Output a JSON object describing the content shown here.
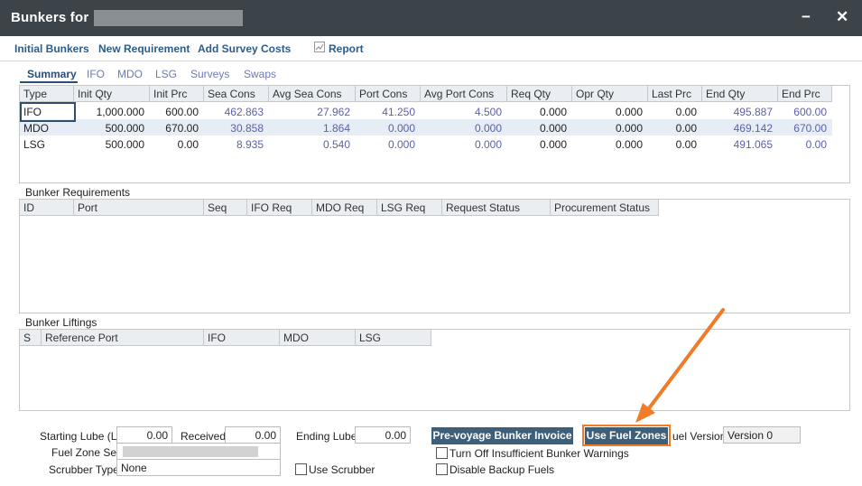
{
  "window": {
    "title": "Bunkers for",
    "minimize_glyph": "−",
    "close_glyph": "✕"
  },
  "toolbar": {
    "initial_bunkers": "Initial Bunkers",
    "new_requirement": "New Requirement",
    "add_survey_costs": "Add Survey Costs",
    "report": "Report",
    "report_icon": "chart-icon"
  },
  "tabs": [
    "Summary",
    "IFO",
    "MDO",
    "LSG",
    "Surveys",
    "Swaps"
  ],
  "summary": {
    "columns": [
      "Type",
      "Init Qty",
      "Init Prc",
      "Sea Cons",
      "Avg Sea Cons",
      "Port Cons",
      "Avg Port Cons",
      "Req Qty",
      "Opr Qty",
      "Last Prc",
      "End Qty",
      "End Prc"
    ],
    "rows": [
      [
        "IFO",
        "1,000.000",
        "600.00",
        "462.863",
        "27.962",
        "41.250",
        "4.500",
        "0.000",
        "0.000",
        "0.00",
        "495.887",
        "600.00"
      ],
      [
        "MDO",
        "500.000",
        "670.00",
        "30.858",
        "1.864",
        "0.000",
        "0.000",
        "0.000",
        "0.000",
        "0.00",
        "469.142",
        "670.00"
      ],
      [
        "LSG",
        "500.000",
        "0.00",
        "8.935",
        "0.540",
        "0.000",
        "0.000",
        "0.000",
        "0.000",
        "0.00",
        "491.065",
        "0.00"
      ]
    ]
  },
  "requirements": {
    "title": "Bunker Requirements",
    "columns": [
      "ID",
      "Port",
      "Seq",
      "IFO Req",
      "MDO Req",
      "LSG Req",
      "Request Status",
      "Procurement Status"
    ]
  },
  "liftings": {
    "title": "Bunker Liftings",
    "columns": [
      "S",
      "Reference Port",
      "IFO",
      "MDO",
      "LSG"
    ]
  },
  "footer": {
    "starting_lube_label": "Starting Lube (L)",
    "starting_lube_value": "0.00",
    "received_label": "Received",
    "received_value": "0.00",
    "ending_lube_label": "Ending Lube",
    "ending_lube_value": "0.00",
    "fuel_zone_set_label": "Fuel Zone Set",
    "scrubber_type_label": "Scrubber Type",
    "scrubber_type_value": "None",
    "use_scrubber_label": "Use Scrubber",
    "pre_voyage_button": "Pre-voyage Bunker Invoice",
    "use_fuel_zones_button": "Use Fuel Zones",
    "fuel_version_label": "uel Version",
    "fuel_version_value": "Version 0",
    "turn_off_warnings_label": "Turn Off Insufficient Bunker Warnings",
    "disable_backup_label": "Disable Backup Fuels"
  },
  "colors": {
    "titlebar": "#3d4449",
    "link": "#2b5c8a",
    "highlight": "#f07c2a",
    "button": "#3d5f7a",
    "blue_value": "#5b5fb0"
  }
}
